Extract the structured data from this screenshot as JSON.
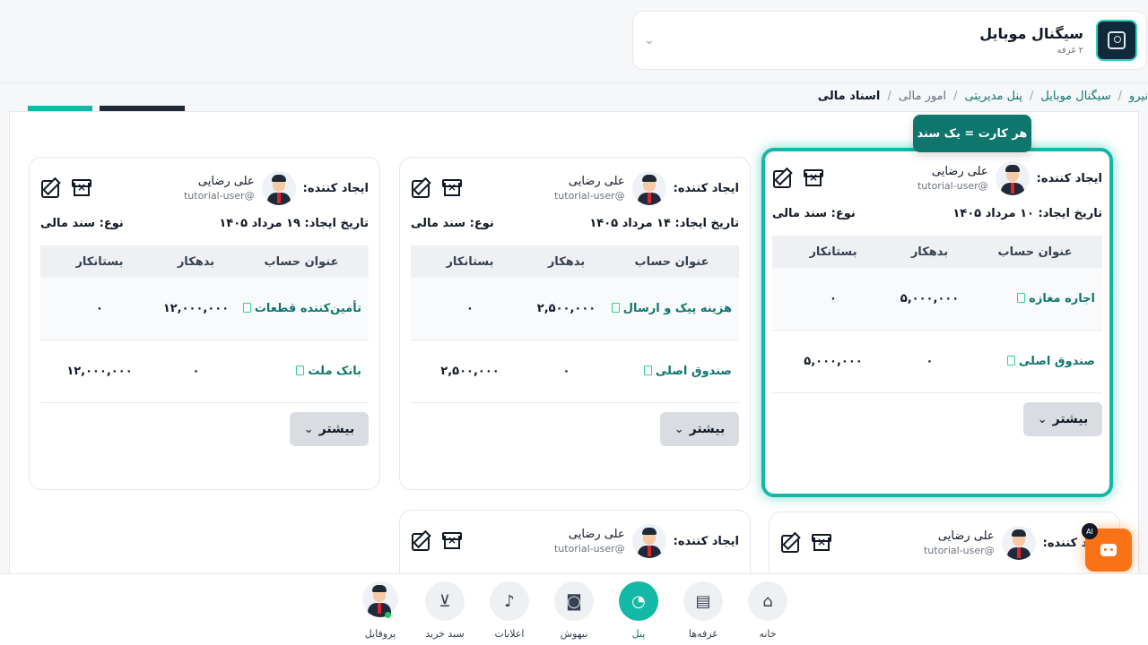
{
  "store": {
    "name": "سیگنال موبایل",
    "sub": "۲ غرفه",
    "chevron": "⌄"
  },
  "breadcrumb": {
    "items": [
      "نیرو",
      "سیگنال موبایل",
      "پنل مدیریتی",
      "امور مالی",
      "اسناد مالی"
    ],
    "separator": "/"
  },
  "tooltip": "هر کارت = یک سند",
  "common": {
    "creator_label": "ایجاد کننده:",
    "user_name": "علی رضایی",
    "user_handle": "tutorial-user@",
    "type_label": "نوع: سند مالی",
    "col_account": "عنوان حساب",
    "col_debit": "بدهکار",
    "col_credit": "بستانکار",
    "more": "بیشتر",
    "more_chevron": "⌄"
  },
  "cards": [
    {
      "date": "تاریخ ایجاد: ۱۰ مرداد ۱۴۰۵",
      "rows": [
        {
          "account": "اجاره مغازه",
          "debit": "۵,۰۰۰,۰۰۰",
          "credit": "۰"
        },
        {
          "account": "صندوق اصلی",
          "debit": "۰",
          "credit": "۵,۰۰۰,۰۰۰"
        }
      ]
    },
    {
      "date": "تاریخ ایجاد: ۱۴ مرداد ۱۴۰۵",
      "rows": [
        {
          "account": "هزینه پیک و ارسال",
          "debit": "۲,۵۰۰,۰۰۰",
          "credit": "۰"
        },
        {
          "account": "صندوق اصلی",
          "debit": "۰",
          "credit": "۲,۵۰۰,۰۰۰"
        }
      ]
    },
    {
      "date": "تاریخ ایجاد: ۱۹ مرداد ۱۴۰۵",
      "rows": [
        {
          "account": "تأمین‌کننده قطعات",
          "debit": "۱۲,۰۰۰,۰۰۰",
          "credit": "۰"
        },
        {
          "account": "بانک ملت",
          "debit": "۰",
          "credit": "۱۲,۰۰۰,۰۰۰"
        }
      ]
    }
  ],
  "nav": {
    "home": "خانه",
    "booths": "غرفه‌ها",
    "panel": "پنل",
    "ai": "نیهوش",
    "notifications": "اعلانات",
    "cart": "سبد خرید",
    "profile": "پروفایل"
  },
  "ai_badge": "AI",
  "colors": {
    "accent": "#14b8a6",
    "accent_dark": "#0f766e",
    "fab": "#f97316"
  }
}
